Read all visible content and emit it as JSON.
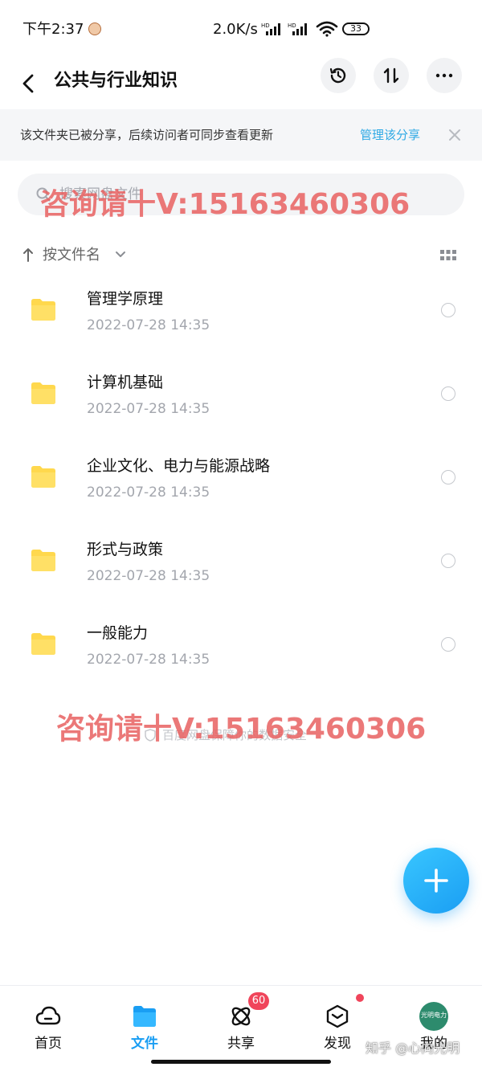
{
  "status_bar": {
    "time": "下午2:37",
    "network_speed": "2.0K/s",
    "battery": "33"
  },
  "header": {
    "title": "公共与行业知识"
  },
  "share_banner": {
    "text": "该文件夹已被分享，后续访问者可同步查看更新",
    "manage_label": "管理该分享"
  },
  "search": {
    "placeholder": "搜索网盘文件"
  },
  "watermarks": {
    "top": "咨询请十V:15163460306",
    "bottom": "咨询请十V:15163460306"
  },
  "sort": {
    "label": "按文件名"
  },
  "files": [
    {
      "name": "管理学原理",
      "date": "2022-07-28  14:35"
    },
    {
      "name": "计算机基础",
      "date": "2022-07-28  14:35"
    },
    {
      "name": "企业文化、电力与能源战略",
      "date": "2022-07-28  14:35"
    },
    {
      "name": "形式与政策",
      "date": "2022-07-28  14:35"
    },
    {
      "name": "一般能力",
      "date": "2022-07-28  14:35"
    }
  ],
  "footer_note": "百度网盘保障你的数据安全",
  "bottom_nav": {
    "items": [
      {
        "label": "首页"
      },
      {
        "label": "文件"
      },
      {
        "label": "共享",
        "badge": "60"
      },
      {
        "label": "发现"
      },
      {
        "label": "我的",
        "avatar_text": "光明电力"
      }
    ]
  },
  "zhihu_watermark": "知乎 @心向光明",
  "colors": {
    "accent": "#1a9ef3",
    "banner_link": "#2fa9e5",
    "badge": "#f0455b",
    "folder": "#ffd84d"
  }
}
